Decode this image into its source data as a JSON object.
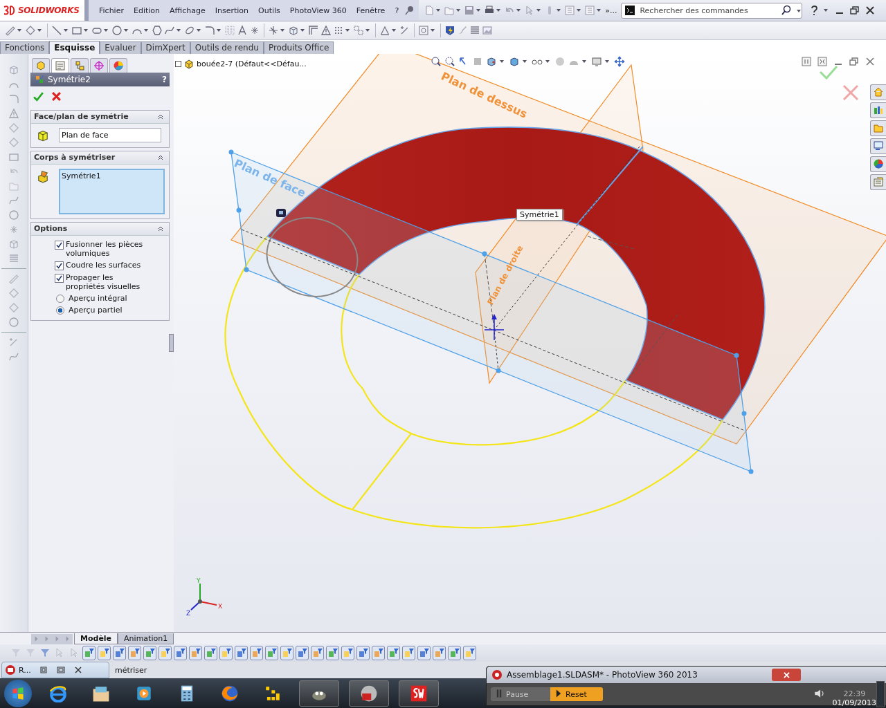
{
  "app": {
    "logo": "SOLIDWORKS",
    "menu": [
      "Fichier",
      "Edition",
      "Affichage",
      "Insertion",
      "Outils",
      "PhotoView 360",
      "Fenêtre",
      "?"
    ],
    "more": "»...",
    "search": {
      "placeholder": "Rechercher des commandes"
    }
  },
  "tabs": [
    {
      "label": "Fonctions",
      "selected": false
    },
    {
      "label": "Esquisse",
      "selected": true
    },
    {
      "label": "Evaluer",
      "selected": false
    },
    {
      "label": "DimXpert",
      "selected": false
    },
    {
      "label": "Outils de rendu",
      "selected": false
    },
    {
      "label": "Produits Office",
      "selected": false
    }
  ],
  "property_manager": {
    "title": "Symétrie2",
    "help": "?",
    "sections": [
      {
        "title": "Face/plan de symétrie",
        "kind": "field",
        "value": "Plan de face"
      },
      {
        "title": "Corps à symétriser",
        "kind": "list",
        "items": [
          "Symétrie1"
        ]
      },
      {
        "title": "Options",
        "kind": "options",
        "options": [
          {
            "kind": "checkbox",
            "label": "Fusionner les pièces volumiques",
            "checked": true
          },
          {
            "kind": "checkbox",
            "label": "Coudre les surfaces",
            "checked": true
          },
          {
            "kind": "checkbox",
            "label": "Propager les propriétés visuelles",
            "checked": true
          },
          {
            "kind": "radio",
            "label": "Aperçu intégral",
            "selected": false
          },
          {
            "kind": "radio",
            "label": "Aperçu partiel",
            "selected": true
          }
        ]
      }
    ]
  },
  "viewport": {
    "tree_root": "bouée2-7  (Défaut<<Défau...",
    "planes": [
      "Plan de dessus",
      "Plan de face",
      "Plan de droite"
    ],
    "tooltip": "Symétrie1",
    "axes": [
      "Y",
      "Z",
      "X"
    ]
  },
  "bottom_tabs": [
    {
      "label": "Modèle",
      "selected": true
    },
    {
      "label": "Animation1",
      "selected": false
    }
  ],
  "taskbar": {
    "minimized_window": "R...",
    "status_text": "métriser",
    "photoview": {
      "title": "Assemblage1.SLDASM* - PhotoView 360 2013",
      "buttons": [
        {
          "label": "Pause",
          "kind": "pause"
        },
        {
          "label": "Reset",
          "kind": "reset"
        }
      ]
    },
    "time": "22:39",
    "date": "01/09/2013"
  }
}
